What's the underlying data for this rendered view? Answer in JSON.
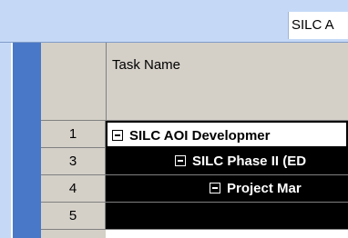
{
  "header": {
    "title_fragment": "SILC A"
  },
  "table": {
    "column_header": "Task Name",
    "rows": [
      {
        "id": "1",
        "name": "SILC AOI Developmer",
        "expanded": true
      },
      {
        "id": "3",
        "name": "SILC Phase II (ED",
        "expanded": true
      },
      {
        "id": "4",
        "name": "Project Mar",
        "expanded": true
      },
      {
        "id": "5",
        "name": "",
        "expanded": false
      }
    ]
  },
  "colors": {
    "header_band": "#c5d9f7",
    "blue_strip": "#4a78c8",
    "grey_columns": "#d4d0c8",
    "selected_row_bg": "#000000"
  }
}
